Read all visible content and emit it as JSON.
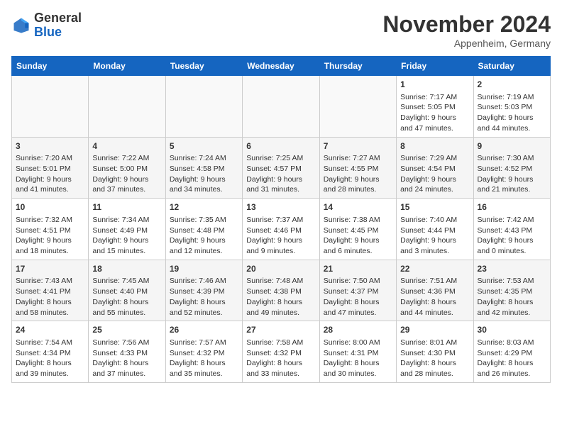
{
  "logo": {
    "general": "General",
    "blue": "Blue"
  },
  "header": {
    "title": "November 2024",
    "location": "Appenheim, Germany"
  },
  "weekdays": [
    "Sunday",
    "Monday",
    "Tuesday",
    "Wednesday",
    "Thursday",
    "Friday",
    "Saturday"
  ],
  "weeks": [
    [
      {
        "day": "",
        "sunrise": "",
        "sunset": "",
        "daylight": ""
      },
      {
        "day": "",
        "sunrise": "",
        "sunset": "",
        "daylight": ""
      },
      {
        "day": "",
        "sunrise": "",
        "sunset": "",
        "daylight": ""
      },
      {
        "day": "",
        "sunrise": "",
        "sunset": "",
        "daylight": ""
      },
      {
        "day": "",
        "sunrise": "",
        "sunset": "",
        "daylight": ""
      },
      {
        "day": "1",
        "sunrise": "Sunrise: 7:17 AM",
        "sunset": "Sunset: 5:05 PM",
        "daylight": "Daylight: 9 hours and 47 minutes."
      },
      {
        "day": "2",
        "sunrise": "Sunrise: 7:19 AM",
        "sunset": "Sunset: 5:03 PM",
        "daylight": "Daylight: 9 hours and 44 minutes."
      }
    ],
    [
      {
        "day": "3",
        "sunrise": "Sunrise: 7:20 AM",
        "sunset": "Sunset: 5:01 PM",
        "daylight": "Daylight: 9 hours and 41 minutes."
      },
      {
        "day": "4",
        "sunrise": "Sunrise: 7:22 AM",
        "sunset": "Sunset: 5:00 PM",
        "daylight": "Daylight: 9 hours and 37 minutes."
      },
      {
        "day": "5",
        "sunrise": "Sunrise: 7:24 AM",
        "sunset": "Sunset: 4:58 PM",
        "daylight": "Daylight: 9 hours and 34 minutes."
      },
      {
        "day": "6",
        "sunrise": "Sunrise: 7:25 AM",
        "sunset": "Sunset: 4:57 PM",
        "daylight": "Daylight: 9 hours and 31 minutes."
      },
      {
        "day": "7",
        "sunrise": "Sunrise: 7:27 AM",
        "sunset": "Sunset: 4:55 PM",
        "daylight": "Daylight: 9 hours and 28 minutes."
      },
      {
        "day": "8",
        "sunrise": "Sunrise: 7:29 AM",
        "sunset": "Sunset: 4:54 PM",
        "daylight": "Daylight: 9 hours and 24 minutes."
      },
      {
        "day": "9",
        "sunrise": "Sunrise: 7:30 AM",
        "sunset": "Sunset: 4:52 PM",
        "daylight": "Daylight: 9 hours and 21 minutes."
      }
    ],
    [
      {
        "day": "10",
        "sunrise": "Sunrise: 7:32 AM",
        "sunset": "Sunset: 4:51 PM",
        "daylight": "Daylight: 9 hours and 18 minutes."
      },
      {
        "day": "11",
        "sunrise": "Sunrise: 7:34 AM",
        "sunset": "Sunset: 4:49 PM",
        "daylight": "Daylight: 9 hours and 15 minutes."
      },
      {
        "day": "12",
        "sunrise": "Sunrise: 7:35 AM",
        "sunset": "Sunset: 4:48 PM",
        "daylight": "Daylight: 9 hours and 12 minutes."
      },
      {
        "day": "13",
        "sunrise": "Sunrise: 7:37 AM",
        "sunset": "Sunset: 4:46 PM",
        "daylight": "Daylight: 9 hours and 9 minutes."
      },
      {
        "day": "14",
        "sunrise": "Sunrise: 7:38 AM",
        "sunset": "Sunset: 4:45 PM",
        "daylight": "Daylight: 9 hours and 6 minutes."
      },
      {
        "day": "15",
        "sunrise": "Sunrise: 7:40 AM",
        "sunset": "Sunset: 4:44 PM",
        "daylight": "Daylight: 9 hours and 3 minutes."
      },
      {
        "day": "16",
        "sunrise": "Sunrise: 7:42 AM",
        "sunset": "Sunset: 4:43 PM",
        "daylight": "Daylight: 9 hours and 0 minutes."
      }
    ],
    [
      {
        "day": "17",
        "sunrise": "Sunrise: 7:43 AM",
        "sunset": "Sunset: 4:41 PM",
        "daylight": "Daylight: 8 hours and 58 minutes."
      },
      {
        "day": "18",
        "sunrise": "Sunrise: 7:45 AM",
        "sunset": "Sunset: 4:40 PM",
        "daylight": "Daylight: 8 hours and 55 minutes."
      },
      {
        "day": "19",
        "sunrise": "Sunrise: 7:46 AM",
        "sunset": "Sunset: 4:39 PM",
        "daylight": "Daylight: 8 hours and 52 minutes."
      },
      {
        "day": "20",
        "sunrise": "Sunrise: 7:48 AM",
        "sunset": "Sunset: 4:38 PM",
        "daylight": "Daylight: 8 hours and 49 minutes."
      },
      {
        "day": "21",
        "sunrise": "Sunrise: 7:50 AM",
        "sunset": "Sunset: 4:37 PM",
        "daylight": "Daylight: 8 hours and 47 minutes."
      },
      {
        "day": "22",
        "sunrise": "Sunrise: 7:51 AM",
        "sunset": "Sunset: 4:36 PM",
        "daylight": "Daylight: 8 hours and 44 minutes."
      },
      {
        "day": "23",
        "sunrise": "Sunrise: 7:53 AM",
        "sunset": "Sunset: 4:35 PM",
        "daylight": "Daylight: 8 hours and 42 minutes."
      }
    ],
    [
      {
        "day": "24",
        "sunrise": "Sunrise: 7:54 AM",
        "sunset": "Sunset: 4:34 PM",
        "daylight": "Daylight: 8 hours and 39 minutes."
      },
      {
        "day": "25",
        "sunrise": "Sunrise: 7:56 AM",
        "sunset": "Sunset: 4:33 PM",
        "daylight": "Daylight: 8 hours and 37 minutes."
      },
      {
        "day": "26",
        "sunrise": "Sunrise: 7:57 AM",
        "sunset": "Sunset: 4:32 PM",
        "daylight": "Daylight: 8 hours and 35 minutes."
      },
      {
        "day": "27",
        "sunrise": "Sunrise: 7:58 AM",
        "sunset": "Sunset: 4:32 PM",
        "daylight": "Daylight: 8 hours and 33 minutes."
      },
      {
        "day": "28",
        "sunrise": "Sunrise: 8:00 AM",
        "sunset": "Sunset: 4:31 PM",
        "daylight": "Daylight: 8 hours and 30 minutes."
      },
      {
        "day": "29",
        "sunrise": "Sunrise: 8:01 AM",
        "sunset": "Sunset: 4:30 PM",
        "daylight": "Daylight: 8 hours and 28 minutes."
      },
      {
        "day": "30",
        "sunrise": "Sunrise: 8:03 AM",
        "sunset": "Sunset: 4:29 PM",
        "daylight": "Daylight: 8 hours and 26 minutes."
      }
    ]
  ]
}
